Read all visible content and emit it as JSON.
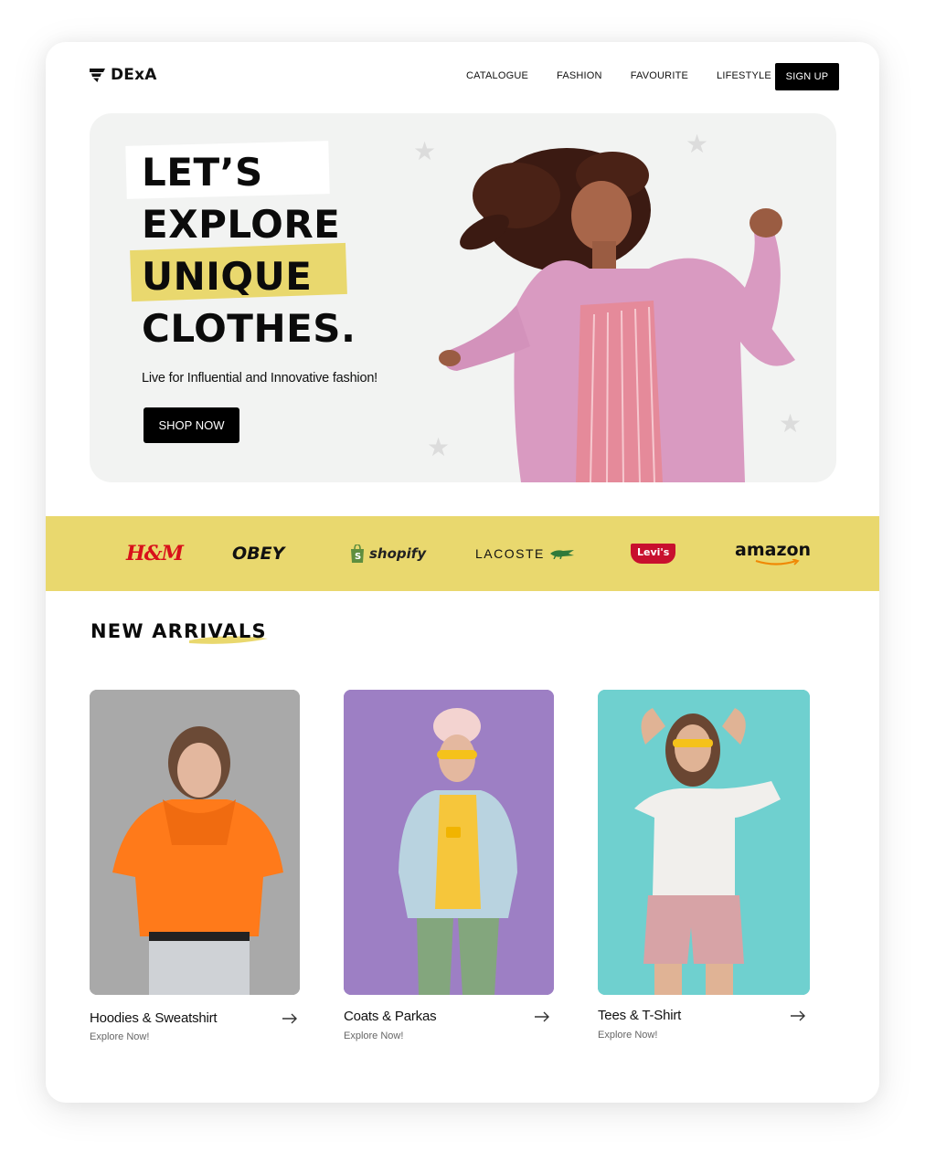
{
  "brand": {
    "name": "DExA",
    "logo_icon": "pennant-logo-icon"
  },
  "nav": {
    "items": [
      "CATALOGUE",
      "FASHION",
      "FAVOURITE",
      "LIFESTYLE"
    ],
    "signup": "SIGN UP"
  },
  "hero": {
    "lines": [
      "LET’S",
      "EXPLORE",
      "UNIQUE",
      "CLOTHES."
    ],
    "subtitle": "Live for Influential and Innovative fashion!",
    "cta": "SHOP NOW"
  },
  "brands": [
    "H&M",
    "OBEY",
    "shopify",
    "LACOSTE",
    "Levi's",
    "amazon"
  ],
  "new_arrivals": {
    "title": "NEW ARRIVALS",
    "products": [
      {
        "name": "Hoodies & Sweatshirt",
        "cta": "Explore Now!"
      },
      {
        "name": "Coats & Parkas",
        "cta": "Explore Now!"
      },
      {
        "name": "Tees & T-Shirt",
        "cta": "Explore Now!"
      }
    ]
  },
  "colors": {
    "accent_yellow": "#e9d86e",
    "black": "#000000",
    "hero_bg": "#f2f3f2"
  }
}
